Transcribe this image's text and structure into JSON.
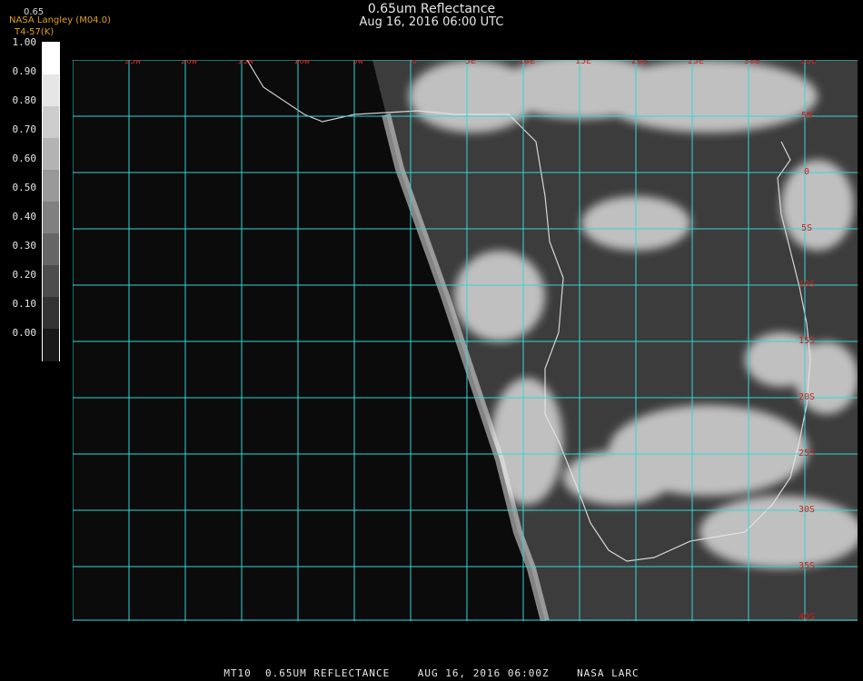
{
  "header": {
    "title": "0.65um Reflectance",
    "datetime": "Aug 16, 2016 06:00 UTC",
    "credit": "NASA Langley (M04.0)",
    "credit_sub": "T4-57(K)",
    "channel_label": "0.65"
  },
  "colorbar": {
    "labels": [
      "1.00",
      "0.90",
      "0.80",
      "0.70",
      "0.60",
      "0.50",
      "0.40",
      "0.30",
      "0.20",
      "0.10",
      "0.00"
    ]
  },
  "map": {
    "lon_labels": [
      "25W",
      "20W",
      "15W",
      "10W",
      "5W",
      "0",
      "5E",
      "10E",
      "15E",
      "20E",
      "25E",
      "30E",
      "35E"
    ],
    "lat_labels": [
      "5N",
      "0",
      "5S",
      "10S",
      "15S",
      "20S",
      "25S",
      "30S",
      "35S",
      "40S"
    ],
    "grid_color": "#33d6d6",
    "label_color": "#cc2222"
  },
  "footer": {
    "text": "MT10  0.65UM REFLECTANCE    AUG 16, 2016 06:00Z    NASA LARC"
  }
}
